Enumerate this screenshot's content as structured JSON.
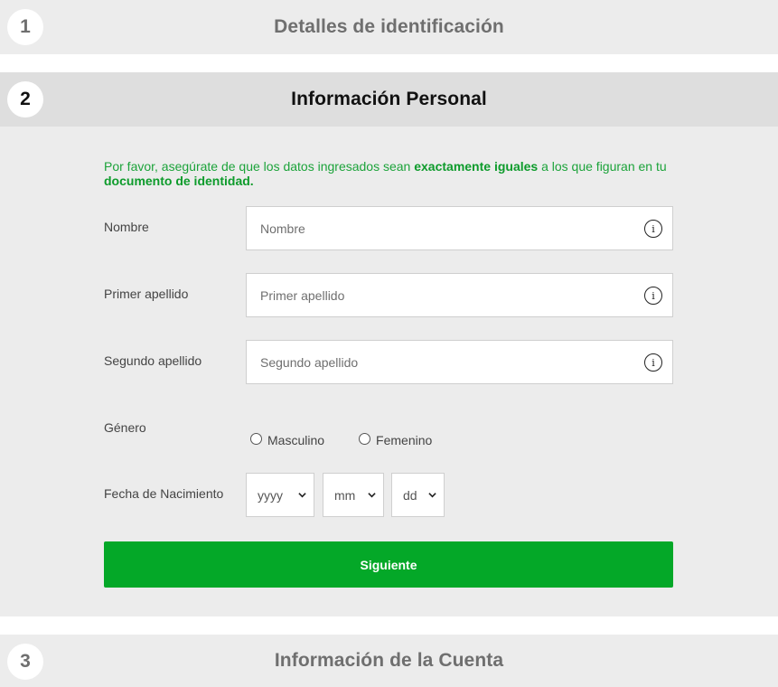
{
  "steps": [
    {
      "number": "1",
      "title": "Detalles de identificación",
      "state": "inactive"
    },
    {
      "number": "2",
      "title": "Información Personal",
      "state": "active"
    },
    {
      "number": "3",
      "title": "Información de la Cuenta",
      "state": "inactive"
    }
  ],
  "notice": {
    "part1": "Por favor, asegúrate de que los datos ingresados sean ",
    "bold1": "exactamente iguales",
    "part2": " a los que figuran en tu ",
    "bold2": "documento de identidad."
  },
  "form": {
    "nombre": {
      "label": "Nombre",
      "placeholder": "Nombre",
      "value": ""
    },
    "primer_apellido": {
      "label": "Primer apellido",
      "placeholder": "Primer apellido",
      "value": ""
    },
    "segundo_apellido": {
      "label": "Segundo apellido",
      "placeholder": "Segundo apellido",
      "value": ""
    },
    "genero": {
      "label": "Género",
      "options": [
        "Masculino",
        "Femenino"
      ]
    },
    "fecha": {
      "label": "Fecha de Nacimiento",
      "year": "yyyy",
      "month": "mm",
      "day": "dd"
    }
  },
  "buttons": {
    "next": "Siguiente"
  },
  "icons": {
    "info": "i"
  },
  "colors": {
    "accent": "#04a828",
    "notice_text": "#1ca33a"
  }
}
